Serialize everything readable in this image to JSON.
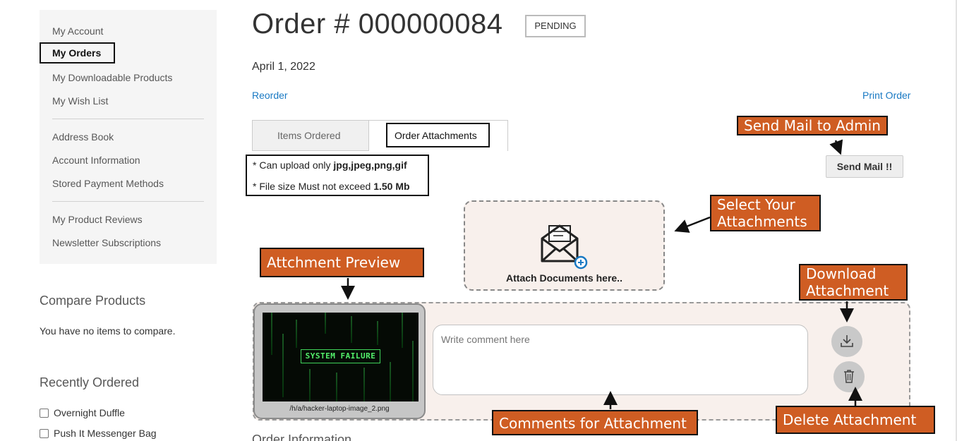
{
  "sidebar": {
    "items": [
      {
        "label": "My Account"
      },
      {
        "label": "My Orders",
        "current": true
      },
      {
        "label": "My Downloadable Products"
      },
      {
        "label": "My Wish List"
      },
      {
        "label": "Address Book"
      },
      {
        "label": "Account Information"
      },
      {
        "label": "Stored Payment Methods"
      },
      {
        "label": "My Product Reviews"
      },
      {
        "label": "Newsletter Subscriptions"
      }
    ],
    "compare": {
      "title": "Compare Products",
      "empty_text": "You have no items to compare."
    },
    "recently_ordered": {
      "title": "Recently Ordered",
      "items": [
        "Overnight Duffle",
        "Push It Messenger Bag"
      ]
    }
  },
  "order": {
    "title": "Order # 000000084",
    "status": "PENDING",
    "date": "April 1, 2022",
    "reorder_label": "Reorder",
    "print_label": "Print Order",
    "section_title_cut": "Order Information"
  },
  "tabs": [
    {
      "label": "Items Ordered"
    },
    {
      "label": "Order Attachments",
      "active": true
    }
  ],
  "upload_rules": {
    "line1_prefix": "* Can upload only ",
    "line1_value": "jpg,jpeg,png,gif",
    "line2_prefix": "* File size Must not exceed ",
    "line2_value": "1.50 Mb"
  },
  "send_mail": {
    "label": "Send Mail !!"
  },
  "dropzone": {
    "label": "Attach Documents here.."
  },
  "attachment": {
    "file_name": "/h/a/hacker-laptop-image_2.png",
    "image_text": "SYSTEM FAILURE",
    "comment_placeholder": "Write comment here"
  },
  "callouts": {
    "send_mail": "Send Mail to Admin",
    "select_line1": "Select Your",
    "select_line2": "Attachments",
    "preview": "Attchment Preview",
    "download_line1": "Download",
    "download_line2": "Attachment",
    "comments": "Comments for Attachment",
    "delete": "Delete Attachment"
  },
  "colors": {
    "callout_bg": "#cf5d23",
    "link": "#1979c3",
    "panel_bg": "#f8f0ec",
    "sidebar_bg": "#f5f5f5"
  },
  "icons": [
    "envelope-icon",
    "plus-circle-icon",
    "download-icon",
    "trash-icon",
    "arrow-icon"
  ]
}
